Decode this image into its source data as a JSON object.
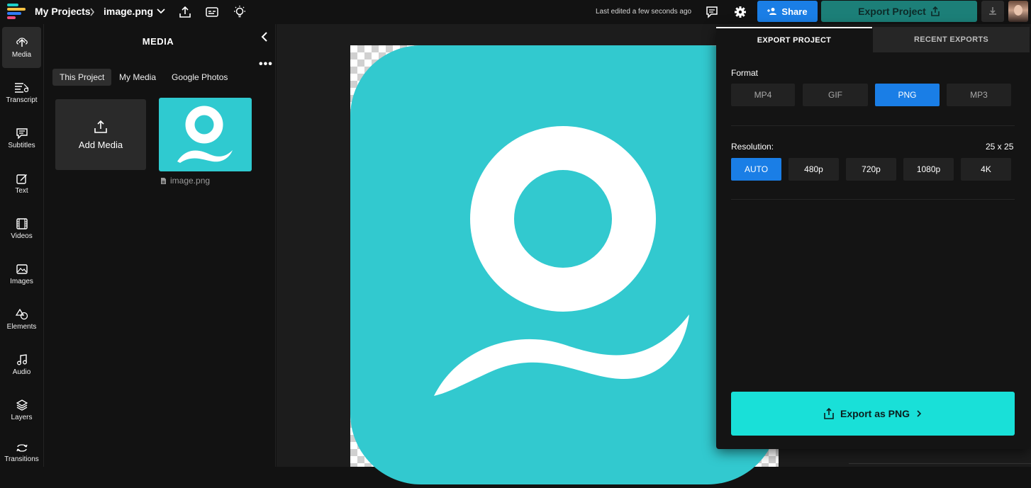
{
  "header": {
    "breadcrumb_root": "My Projects",
    "breadcrumb_file": "image.png",
    "last_edited": "Last edited a few seconds ago",
    "share_label": "Share",
    "export_label": "Export Project"
  },
  "rail": {
    "items": [
      {
        "label": "Media",
        "icon": "upload-cloud-icon"
      },
      {
        "label": "Transcript",
        "icon": "transcript-icon"
      },
      {
        "label": "Subtitles",
        "icon": "subtitles-icon"
      },
      {
        "label": "Text",
        "icon": "text-edit-icon"
      },
      {
        "label": "Videos",
        "icon": "film-icon"
      },
      {
        "label": "Images",
        "icon": "image-icon"
      },
      {
        "label": "Elements",
        "icon": "shapes-icon"
      },
      {
        "label": "Audio",
        "icon": "music-note-icon"
      },
      {
        "label": "Layers",
        "icon": "layers-icon"
      },
      {
        "label": "Transitions",
        "icon": "transition-icon"
      }
    ]
  },
  "media": {
    "title": "MEDIA",
    "tabs": [
      "This Project",
      "My Media",
      "Google Photos"
    ],
    "add_media_label": "Add Media",
    "file_name": "image.png"
  },
  "export_panel": {
    "tab_export": "EXPORT PROJECT",
    "tab_recent": "RECENT EXPORTS",
    "format_label": "Format",
    "formats": [
      "MP4",
      "GIF",
      "PNG",
      "MP3"
    ],
    "selected_format": "PNG",
    "resolution_label": "Resolution:",
    "resolution_size": "25 x 25",
    "resolutions": [
      "AUTO",
      "480p",
      "720p",
      "1080p",
      "4K"
    ],
    "selected_resolution": "AUTO",
    "export_button": "Export as PNG"
  },
  "colors": {
    "accent_blue": "#1a7ee6",
    "export_teal": "#19e0d8",
    "logo_teal": "#32c9cf",
    "panel_bg": "#141414"
  }
}
